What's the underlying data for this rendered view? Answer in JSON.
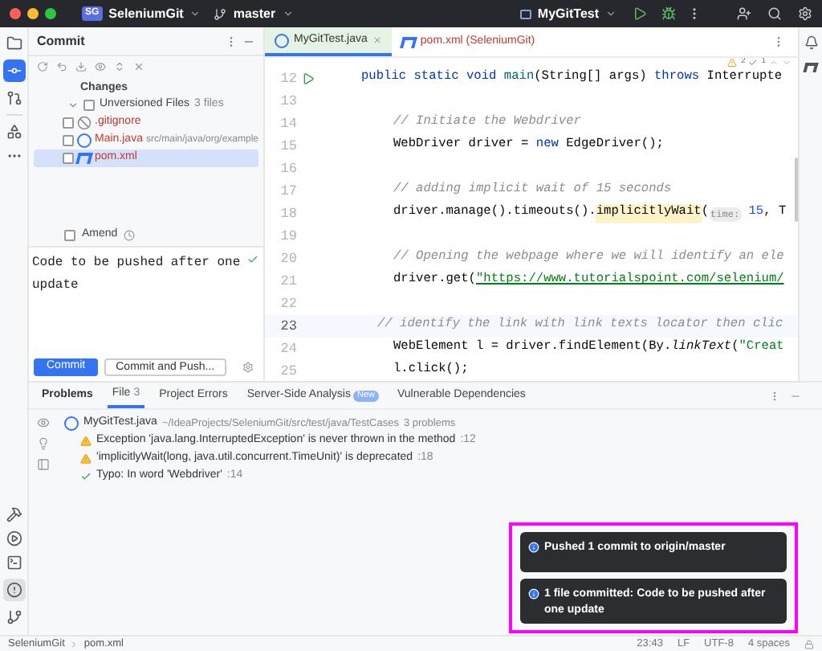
{
  "title_bar": {
    "project_badge": "SG",
    "project": "SeleniumGit",
    "branch": "master",
    "run_config": "MyGitTest"
  },
  "commit_panel": {
    "title": "Commit",
    "section": "Changes",
    "group": {
      "label": "Unversioned Files",
      "count": "3 files",
      "checked": false,
      "expanded": true,
      "children": [
        {
          "name": ".gitignore",
          "kind": "ignore",
          "checked": false,
          "selected": false
        },
        {
          "name": "Main.java",
          "path": "src/main/java/org/example",
          "kind": "java",
          "checked": false,
          "selected": false
        },
        {
          "name": "pom.xml",
          "kind": "maven",
          "checked": false,
          "selected": true
        }
      ]
    },
    "amend": {
      "label": "Amend",
      "checked": false
    },
    "message_lines": [
      "Code to be pushed after one",
      "update"
    ],
    "buttons": [
      {
        "label": "Commit",
        "kind": "primary"
      },
      {
        "label": "Commit and Push...",
        "kind": "secondary"
      }
    ]
  },
  "editor": {
    "tabs": [
      {
        "label": "MyGitTest.java",
        "kind": "java",
        "selected": true
      },
      {
        "label": "pom.xml (SeleniumGit)",
        "kind": "maven",
        "selected": false
      }
    ],
    "inspections": {
      "warnings": "2",
      "typos": "1"
    },
    "lines": [
      {
        "number": "12",
        "kind": "signature",
        "current": false,
        "run_marker": true,
        "tokens": [
          {
            "kind": "keyword",
            "text": "public static void "
          },
          {
            "kind": "method",
            "text": "main"
          },
          {
            "kind": "plain",
            "text": "(String[] args) "
          },
          {
            "kind": "keyword",
            "text": "throws "
          },
          {
            "kind": "plain",
            "text": "Interrupte"
          }
        ]
      },
      {
        "number": "13",
        "kind": "body",
        "current": false,
        "run_marker": false
      },
      {
        "number": "14",
        "kind": "body",
        "current": false,
        "run_marker": false,
        "tokens": [
          {
            "kind": "comment",
            "text": "// Initiate the Webdriver"
          }
        ]
      },
      {
        "number": "15",
        "kind": "body",
        "current": false,
        "run_marker": false,
        "tokens": [
          {
            "kind": "plain",
            "text": "WebDriver driver = "
          },
          {
            "kind": "keyword",
            "text": "new "
          },
          {
            "kind": "plain",
            "text": "EdgeDriver();"
          }
        ]
      },
      {
        "number": "16",
        "kind": "body",
        "current": false,
        "run_marker": false
      },
      {
        "number": "17",
        "kind": "body",
        "current": false,
        "run_marker": false,
        "tokens": [
          {
            "kind": "comment",
            "text": "// adding implicit wait of 15 seconds"
          }
        ]
      },
      {
        "number": "18",
        "kind": "body",
        "current": false,
        "run_marker": false,
        "tokens": [
          {
            "kind": "plain",
            "text": "driver.manage().timeouts()."
          },
          {
            "kind": "deprecated",
            "text": "implicitlyWait"
          },
          {
            "kind": "plain",
            "text": "("
          },
          {
            "kind": "hint",
            "text": "time:"
          },
          {
            "kind": "number",
            "text": " 15"
          },
          {
            "kind": "plain",
            "text": ", T"
          }
        ]
      },
      {
        "number": "19",
        "kind": "body",
        "current": false,
        "run_marker": false
      },
      {
        "number": "20",
        "kind": "body",
        "current": false,
        "run_marker": false,
        "tokens": [
          {
            "kind": "comment",
            "text": "// Opening the webpage where we will identify an ele"
          }
        ]
      },
      {
        "number": "21",
        "kind": "body",
        "current": false,
        "run_marker": false,
        "tokens": [
          {
            "kind": "plain",
            "text": "driver.get("
          },
          {
            "kind": "url",
            "text": "\"https://www.tutorialspoint.com/selenium/"
          }
        ]
      },
      {
        "number": "22",
        "kind": "body",
        "current": false,
        "run_marker": false
      },
      {
        "number": "23",
        "kind": "outdented",
        "current": true,
        "run_marker": false,
        "tokens": [
          {
            "kind": "comment",
            "text": "// identify the link with link texts locator then clic"
          }
        ]
      },
      {
        "number": "24",
        "kind": "body",
        "current": false,
        "run_marker": false,
        "tokens": [
          {
            "kind": "plain",
            "text": "WebElement l = driver.findElement(By."
          },
          {
            "kind": "static",
            "text": "linkText"
          },
          {
            "kind": "plain",
            "text": "("
          },
          {
            "kind": "string",
            "text": "\"Creat"
          }
        ]
      },
      {
        "number": "25",
        "kind": "body",
        "current": false,
        "run_marker": false,
        "tokens": [
          {
            "kind": "plain",
            "text": "l.click();"
          }
        ]
      }
    ]
  },
  "bottom_panel": {
    "tabs": [
      {
        "label": "Problems",
        "kind": "title",
        "selected": false
      },
      {
        "label": "File",
        "count": "3",
        "kind": "tab",
        "selected": true
      },
      {
        "label": "Project Errors",
        "kind": "tab",
        "selected": false
      },
      {
        "label": "Server-Side Analysis",
        "badge": "New",
        "kind": "tab",
        "selected": false
      },
      {
        "label": "Vulnerable Dependencies",
        "kind": "tab",
        "selected": false
      }
    ],
    "file": {
      "name": "MyGitTest.java",
      "path": "~/IdeaProjects/SeleniumGit/src/test/java/TestCases",
      "count": "3 problems",
      "children": [
        {
          "kind": "warning",
          "text": "Exception 'java.lang.InterruptedException' is never thrown in the method",
          "line": ":12"
        },
        {
          "kind": "warning",
          "text": "'implicitlyWait(long, java.util.concurrent.TimeUnit)' is deprecated",
          "line": ":18"
        },
        {
          "kind": "typo",
          "text": "Typo: In word 'Webdriver'",
          "line": ":14"
        }
      ]
    }
  },
  "notifications": [
    "Pushed 1 commit to origin/master",
    "1 file committed: Code to be pushed after one update"
  ],
  "status_bar": {
    "breadcrumbs": [
      "SeleniumGit",
      "pom.xml"
    ],
    "items": [
      "23:43",
      "LF",
      "UTF-8",
      "4 spaces"
    ]
  }
}
